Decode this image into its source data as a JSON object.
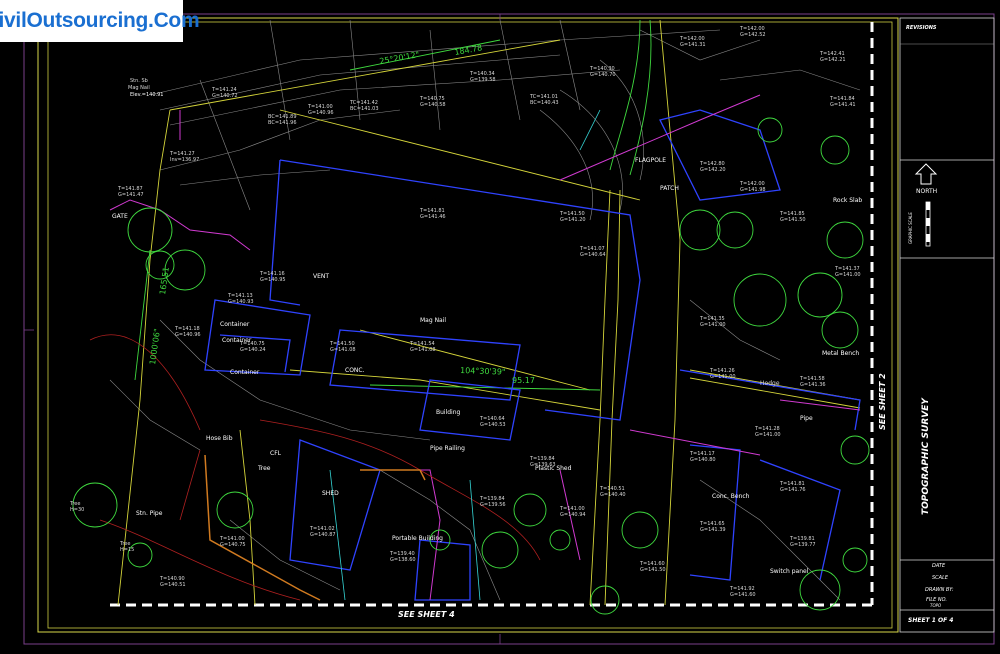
{
  "logo": {
    "text": "CivilOutsourcing.Com"
  },
  "titleblock": {
    "revisions": "REVISIONS",
    "north": "NORTH",
    "graphic_scale": "GRAPHIC SCALE",
    "title": "TOPOGRAPHIC SURVEY",
    "see_sheet_2": "SEE SHEET 2",
    "see_sheet_4": "SEE SHEET 4",
    "sheet": "SHEET 1 OF 4",
    "date": "DATE",
    "scale": "SCALE",
    "drawn_by": "DRAWN BY:",
    "filename": "FILE NO.",
    "topo": "TOPO"
  },
  "labels": {
    "bearing1": "25°20'12\"",
    "dist1": "184.78",
    "bearing2": "104°30'39\"",
    "dist2": "95.17",
    "dist3": "165.51",
    "dist4": "1000'06\"",
    "container1": "Container",
    "container2": "Container",
    "container3": "Container",
    "shed": "SHED",
    "building": "Building",
    "portable": "Portable Building",
    "plastic_shed": "Plastic Shed",
    "conc_bench": "Conc. Bench",
    "hedge": "Hedge",
    "gate": "GATE",
    "tree": "Tree",
    "pipe": "Pipe",
    "conc": "CONC.",
    "stn_pipe": "Stn. Pipe",
    "mag_nail": "Mag Nail",
    "elev": "Elev.=140.91",
    "vent": "VENT",
    "water_lines": "W",
    "metal_bench": "Metal Bench",
    "switch_panel": "Switch panel",
    "flagpole": "FLAGPOLE",
    "patch": "PATCH",
    "hose_bib": "Hose Bib",
    "rock_slab": "Rock Slab",
    "cfl": "CFL",
    "pipe_railing": "Pipe Railing"
  }
}
